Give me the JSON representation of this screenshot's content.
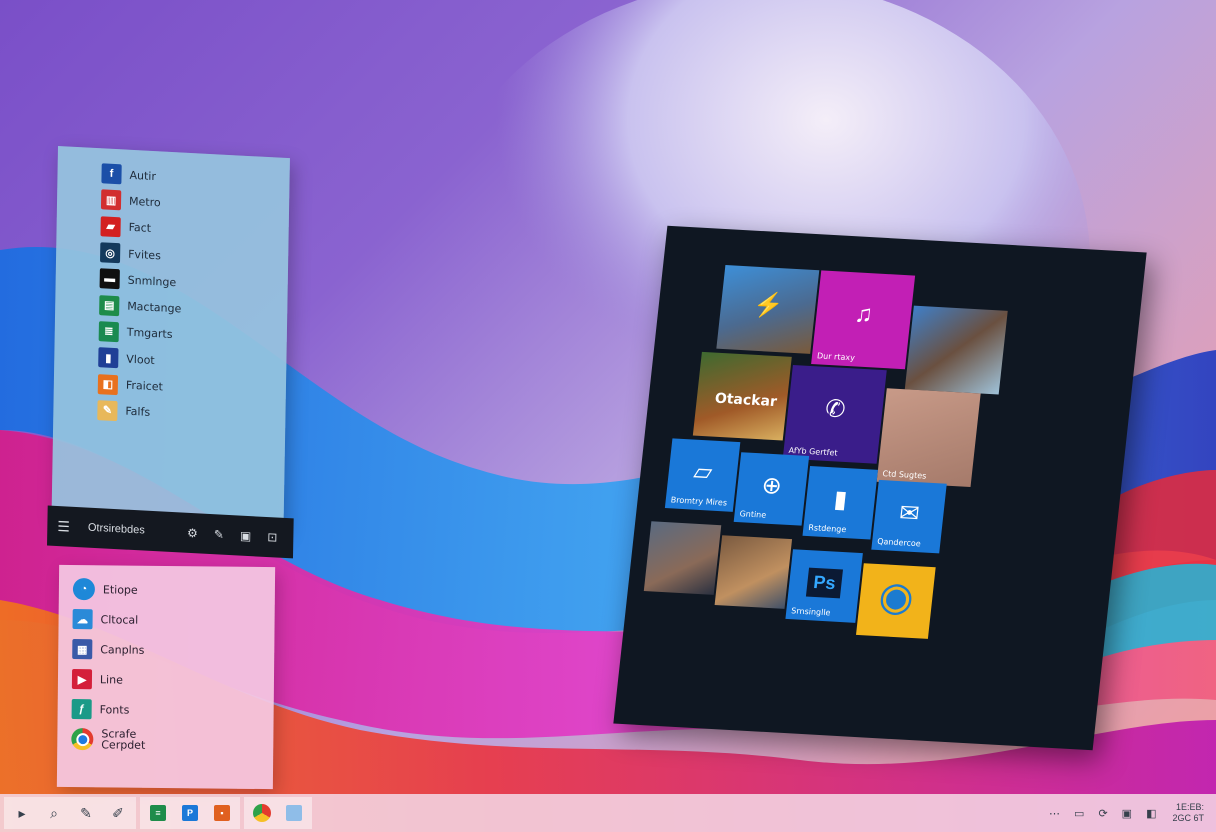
{
  "app_list": {
    "items": [
      {
        "label": "Autir",
        "icon": "facebook-icon",
        "color": "#1b4fa8",
        "glyph": "f"
      },
      {
        "label": "Metro",
        "icon": "news-icon",
        "color": "#d22f2f",
        "glyph": "▥"
      },
      {
        "label": "Fact",
        "icon": "photo-icon",
        "color": "#d32020",
        "glyph": "▰"
      },
      {
        "label": "Fvites",
        "icon": "sync-icon",
        "color": "#143a5c",
        "glyph": "◎"
      },
      {
        "label": "Snmlnge",
        "icon": "terminal-icon",
        "color": "#101010",
        "glyph": "▬"
      },
      {
        "label": "Mactange",
        "icon": "excel-icon",
        "color": "#1e8c4a",
        "glyph": "▤"
      },
      {
        "label": "Tmgarts",
        "icon": "chart-icon",
        "color": "#1a8a50",
        "glyph": "≣"
      },
      {
        "label": "Vloot",
        "icon": "video-icon",
        "color": "#1f3f96",
        "glyph": "▮"
      },
      {
        "label": "Fraicet",
        "icon": "office-icon",
        "color": "#e8711e",
        "glyph": "◧"
      },
      {
        "label": "Falfs",
        "icon": "paint-icon",
        "color": "#e8b85a",
        "glyph": "✎"
      }
    ],
    "footer_label": "Otrsirebdes"
  },
  "recent_list": {
    "items": [
      {
        "label": "Etiope",
        "icon": "globe-icon",
        "color": "#1e88d8",
        "glyph": "◔"
      },
      {
        "label": "Cltocal",
        "icon": "cloud-icon",
        "color": "#2a8ad8",
        "glyph": "☁"
      },
      {
        "label": "Canplns",
        "icon": "photos-icon",
        "color": "#3a5aa8",
        "glyph": "▦"
      },
      {
        "label": "Line",
        "icon": "media-icon",
        "color": "#d41f3a",
        "glyph": "▶"
      },
      {
        "label": "Fonts",
        "icon": "fonts-icon",
        "color": "#1b9a88",
        "glyph": "ƒ"
      },
      {
        "label": "Scrafe\nCerpdet",
        "icon": "chrome-icon",
        "color": "#ffffff",
        "glyph": ""
      }
    ]
  },
  "tiles": [
    {
      "label": "",
      "name": "tile-game-banner",
      "bg": "linear-gradient(160deg,#3d8fd8,#4b6a90 55%,#7a5a3a)",
      "glyph": "⚡"
    },
    {
      "label": "Dur rtaxy",
      "name": "tile-music",
      "bg": "#c21fb5",
      "glyph": "♫"
    },
    {
      "label": "",
      "name": "tile-creature-art",
      "bg": "linear-gradient(140deg,#3f7fc8,#6a5040 50%,#9fc2d9)",
      "glyph": ""
    },
    {
      "label": "Otackar",
      "name": "tile-game-art",
      "bg": "linear-gradient(160deg,#3e6a30,#a05a28 60%,#d9b060)",
      "glyph": ""
    },
    {
      "label": "AfYb Gertfet",
      "name": "tile-phone",
      "bg": "#3a1d8a",
      "glyph": "✆"
    },
    {
      "label": "Ctd Sugtes",
      "name": "tile-photo",
      "bg": "linear-gradient(160deg,#c89a88,#a57a6a)",
      "glyph": ""
    },
    {
      "label": "Bromtry Mires",
      "name": "tile-files",
      "bg": "#1a78d8",
      "glyph": "▱"
    },
    {
      "label": "Gntine",
      "name": "tile-web",
      "bg": "#1a78d8",
      "glyph": "⊕"
    },
    {
      "label": "Rstdenge",
      "name": "tile-books",
      "bg": "#1a78d8",
      "glyph": "▮"
    },
    {
      "label": "Qandercoe",
      "name": "tile-mail",
      "bg": "#1a78d8",
      "glyph": "✉"
    },
    {
      "label": "",
      "name": "tile-art-1",
      "bg": "linear-gradient(150deg,#5a6a80,#8a6a58 60%,#2a3040)",
      "glyph": ""
    },
    {
      "label": "",
      "name": "tile-art-2",
      "bg": "linear-gradient(150deg,#7a5a40,#c09060 60%,#405068)",
      "glyph": ""
    },
    {
      "label": "Srnsinglle",
      "name": "tile-photoshop",
      "bg": "#1a78d8",
      "glyph": "Ps"
    },
    {
      "label": "",
      "name": "tile-orb",
      "bg": "#f2b31a",
      "glyph": "◉"
    }
  ],
  "taskbar": {
    "items": [
      {
        "name": "start-button",
        "glyph": "▸"
      },
      {
        "name": "search-icon",
        "glyph": "⌕"
      },
      {
        "name": "pen-icon",
        "glyph": "✎"
      },
      {
        "name": "tools-icon",
        "glyph": "✐"
      }
    ],
    "apps": [
      {
        "name": "taskbar-sheets",
        "color": "#1e8c4a",
        "glyph": "≡"
      },
      {
        "name": "taskbar-word",
        "color": "#1a78d8",
        "glyph": "P"
      },
      {
        "name": "taskbar-office",
        "color": "#e06020",
        "glyph": "▪"
      }
    ],
    "pinned": [
      {
        "name": "taskbar-chrome",
        "color": "#ffffff"
      },
      {
        "name": "taskbar-files",
        "color": "#8fbde8"
      }
    ],
    "tray_glyphs": [
      "⋯",
      "▭",
      "⟳",
      "▣",
      "◧"
    ],
    "clock_time": "1E:EB:",
    "clock_date": "2GС 6T"
  },
  "colors": {
    "accent": "#1a78d8",
    "panel_dark": "#0f1722"
  }
}
